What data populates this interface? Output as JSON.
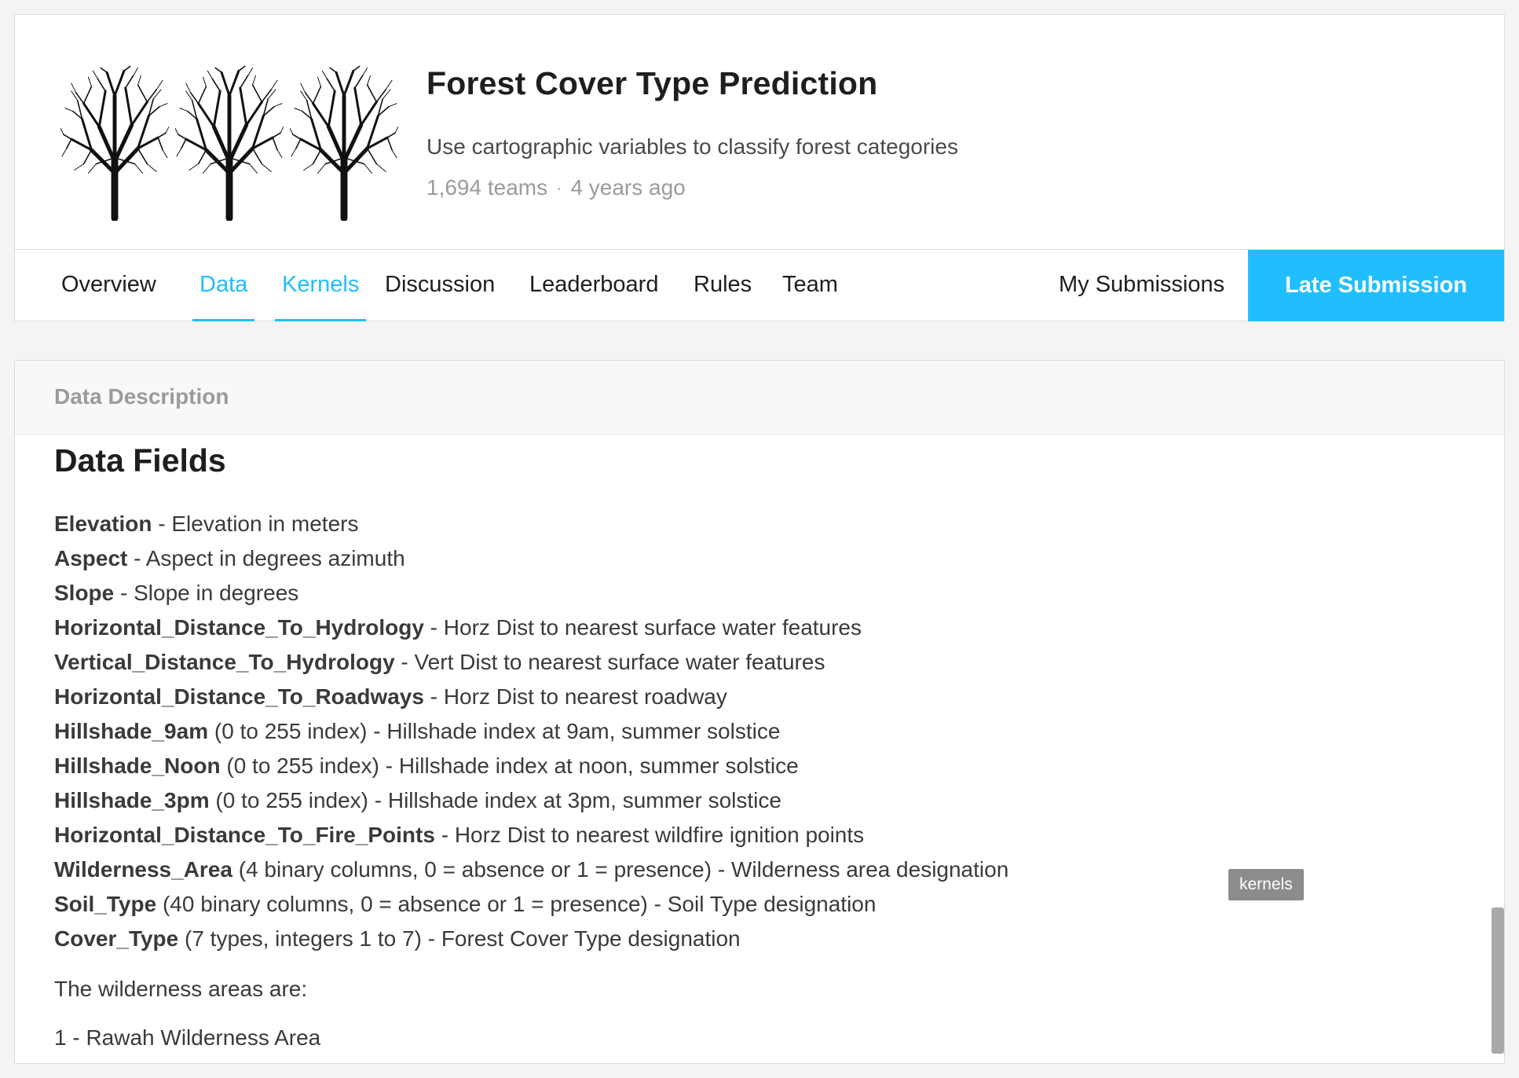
{
  "header": {
    "title": "Forest Cover Type Prediction",
    "subtitle": "Use cartographic variables to classify forest categories",
    "teams": "1,694 teams",
    "separator": "·",
    "age": "4 years ago",
    "image_icon": "tree-icon"
  },
  "tabs": [
    {
      "label": "Overview"
    },
    {
      "label": "Data"
    },
    {
      "label": "Kernels"
    },
    {
      "label": "Discussion"
    },
    {
      "label": "Leaderboard"
    },
    {
      "label": "Rules"
    },
    {
      "label": "Team"
    }
  ],
  "my_submissions": "My Submissions",
  "late_submission": "Late Submission",
  "accent_color": "#20beff",
  "content": {
    "card_header": "Data Description",
    "section_title": "Data Fields",
    "fields": [
      {
        "name": "Elevation",
        "note": "",
        "desc": " - Elevation in meters"
      },
      {
        "name": "Aspect",
        "note": "",
        "desc": " - Aspect in degrees azimuth"
      },
      {
        "name": "Slope",
        "note": "",
        "desc": " - Slope in degrees"
      },
      {
        "name": "Horizontal_Distance_To_Hydrology",
        "note": "",
        "desc": " - Horz Dist to nearest surface water features"
      },
      {
        "name": "Vertical_Distance_To_Hydrology",
        "note": "",
        "desc": " - Vert Dist to nearest surface water features"
      },
      {
        "name": "Horizontal_Distance_To_Roadways",
        "note": "",
        "desc": " - Horz Dist to nearest roadway"
      },
      {
        "name": "Hillshade_9am",
        "note": " (0 to 255 index)",
        "desc": " - Hillshade index at 9am, summer solstice"
      },
      {
        "name": "Hillshade_Noon",
        "note": " (0 to 255 index)",
        "desc": " - Hillshade index at noon, summer solstice"
      },
      {
        "name": "Hillshade_3pm",
        "note": " (0 to 255 index)",
        "desc": " - Hillshade index at 3pm, summer solstice"
      },
      {
        "name": "Horizontal_Distance_To_Fire_Points",
        "note": "",
        "desc": " - Horz Dist to nearest wildfire ignition points"
      },
      {
        "name": "Wilderness_Area",
        "note": " (4 binary columns, 0 = absence or 1 = presence)",
        "desc": " - Wilderness area designation"
      },
      {
        "name": "Soil_Type",
        "note": " (40 binary columns, 0 = absence or 1 = presence)",
        "desc": " - Soil Type designation"
      },
      {
        "name": "Cover_Type",
        "note": " (7 types, integers 1 to 7)",
        "desc": " - Forest Cover Type designation"
      }
    ],
    "wilderness_intro": "The wilderness areas are:",
    "wilderness_first": "1 - Rawah Wilderness Area"
  },
  "tooltip": "kernels"
}
